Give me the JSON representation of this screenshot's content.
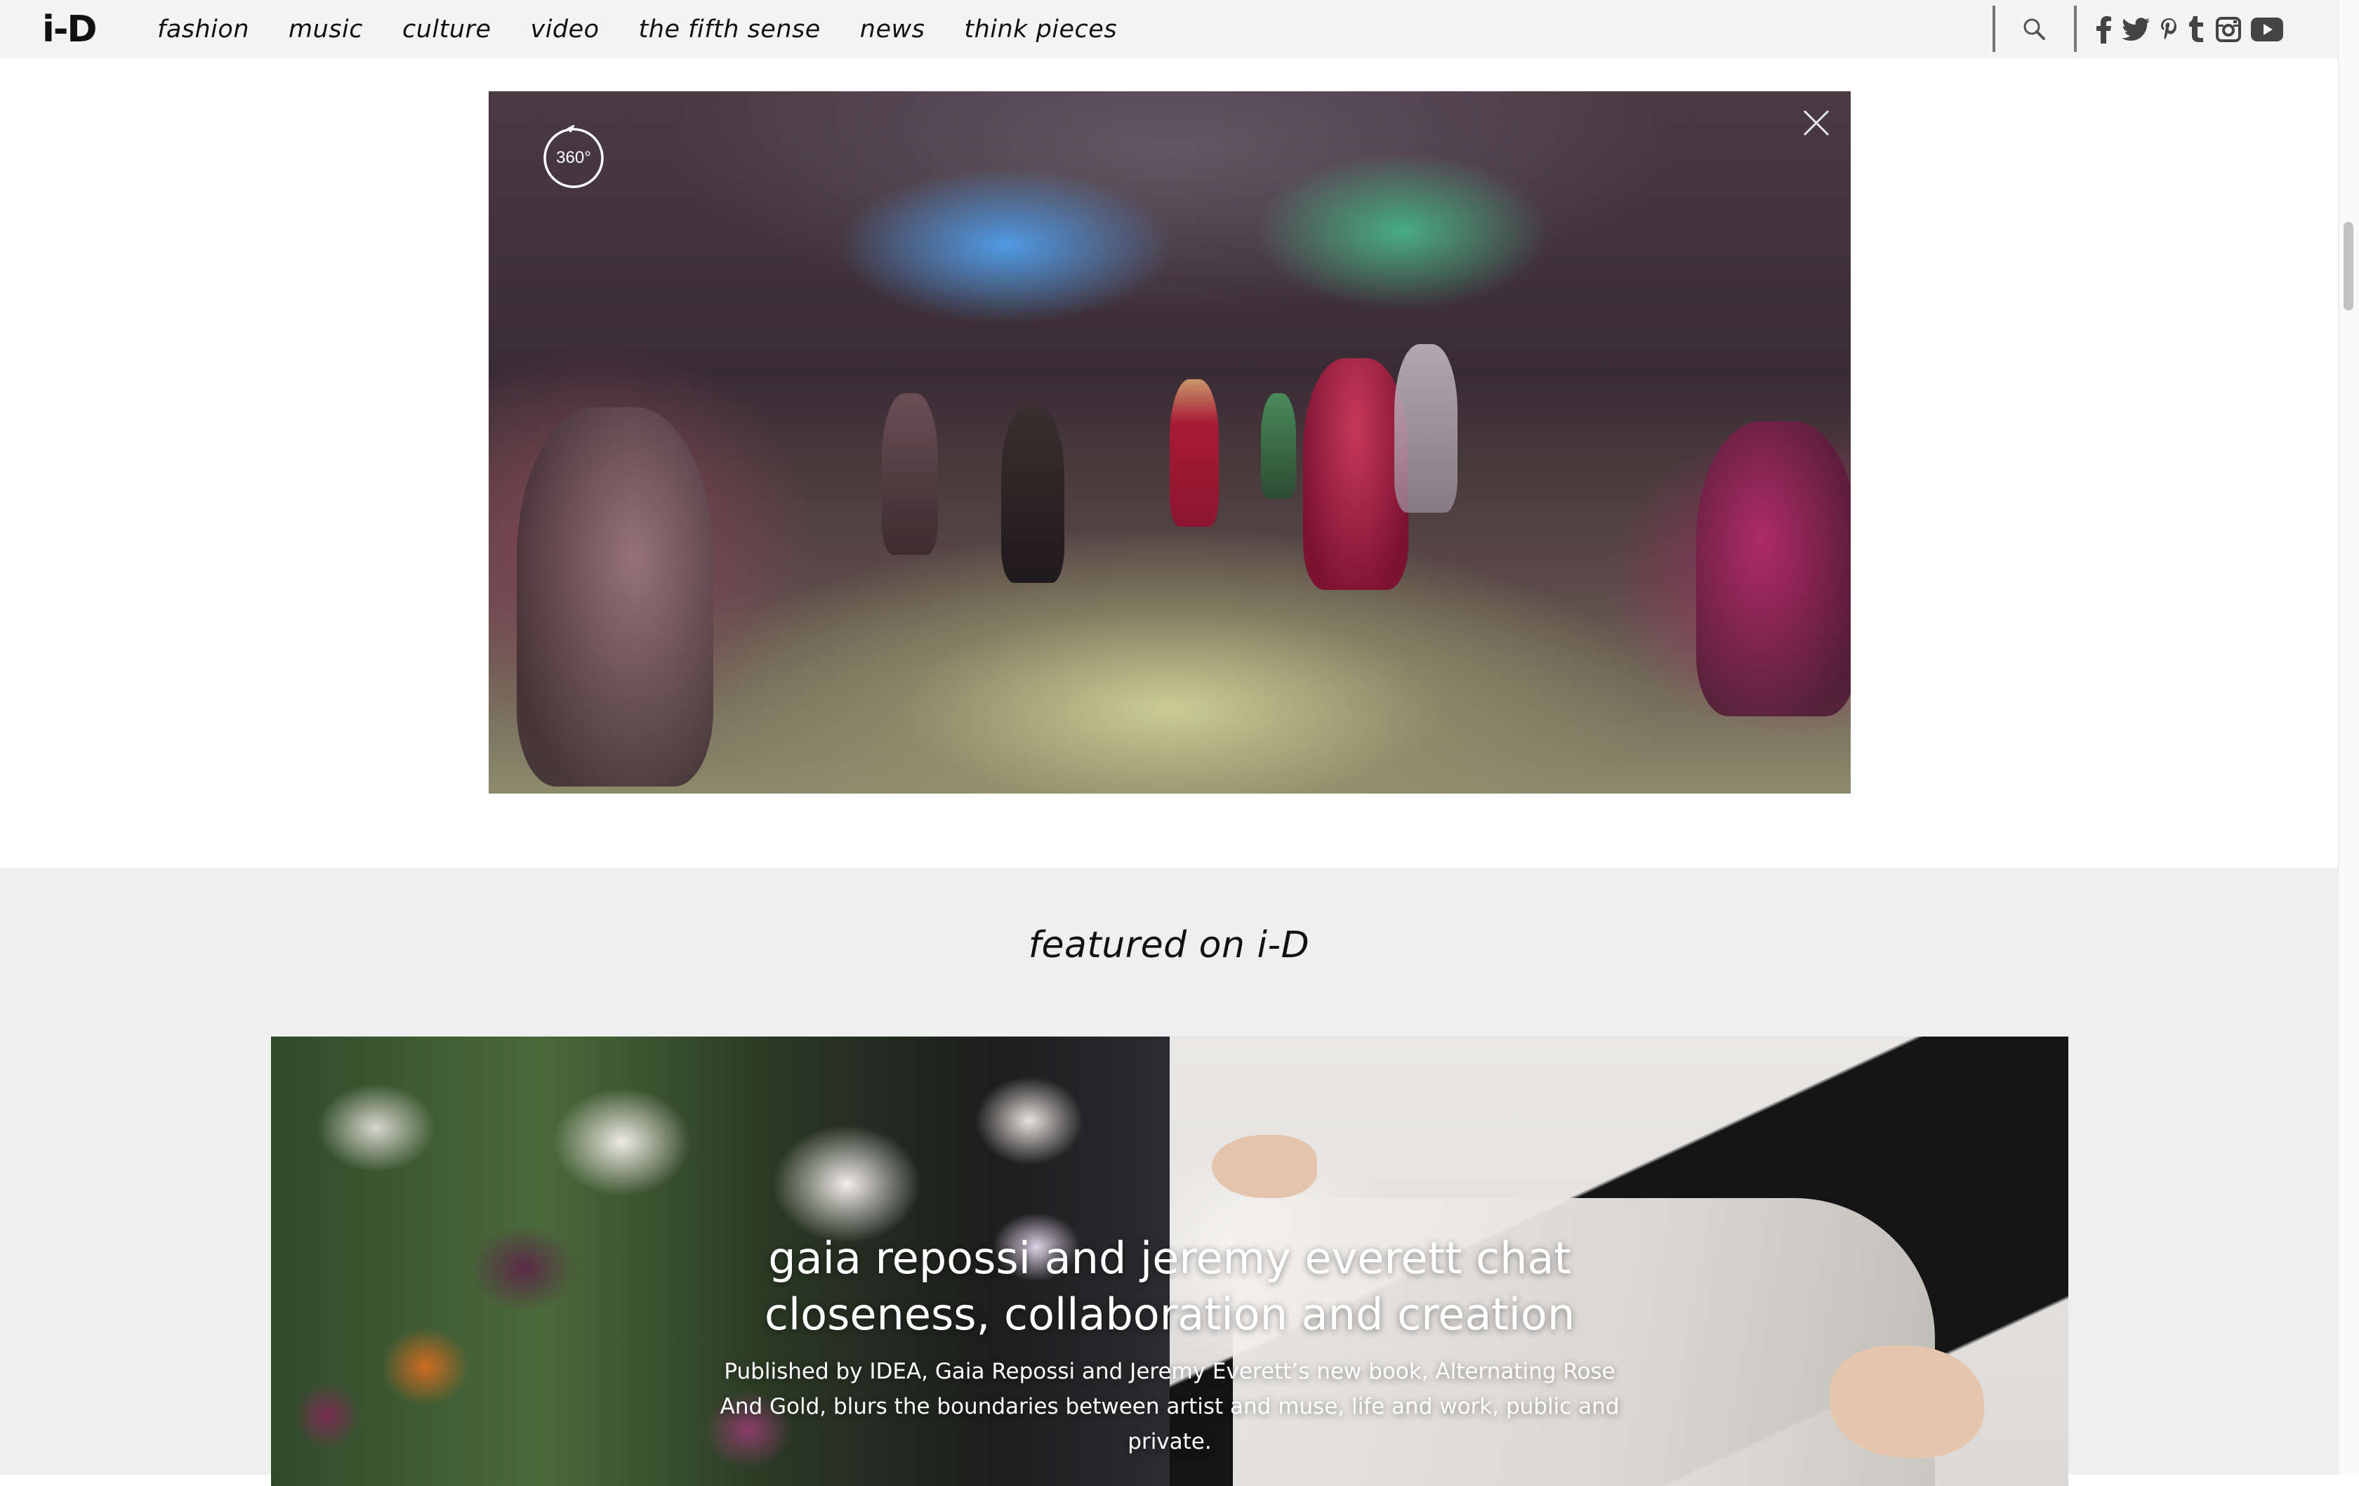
{
  "nav": {
    "logo": "i-D",
    "links": [
      "fashion",
      "music",
      "culture",
      "video",
      "the fifth sense",
      "news",
      "think pieces"
    ],
    "icons": {
      "search": "search-icon",
      "social": [
        "facebook-icon",
        "twitter-icon",
        "pinterest-icon",
        "tumblr-icon",
        "instagram-icon",
        "youtube-icon"
      ]
    }
  },
  "video": {
    "badge": "360°",
    "close": "close-icon"
  },
  "featured": {
    "title": "featured on i-D",
    "card": {
      "headline": "gaia repossi and jeremy everett chat closeness, collaboration and creation",
      "description": "Published by IDEA, Gaia Repossi and Jeremy Everett’s new book, Alternating Rose And Gold, blurs the boundaries between artist and muse, life and work, public and private."
    }
  },
  "colors": {
    "nav_bg": "#f4f4f5",
    "featured_bg": "#efefef",
    "text": "#111111"
  }
}
